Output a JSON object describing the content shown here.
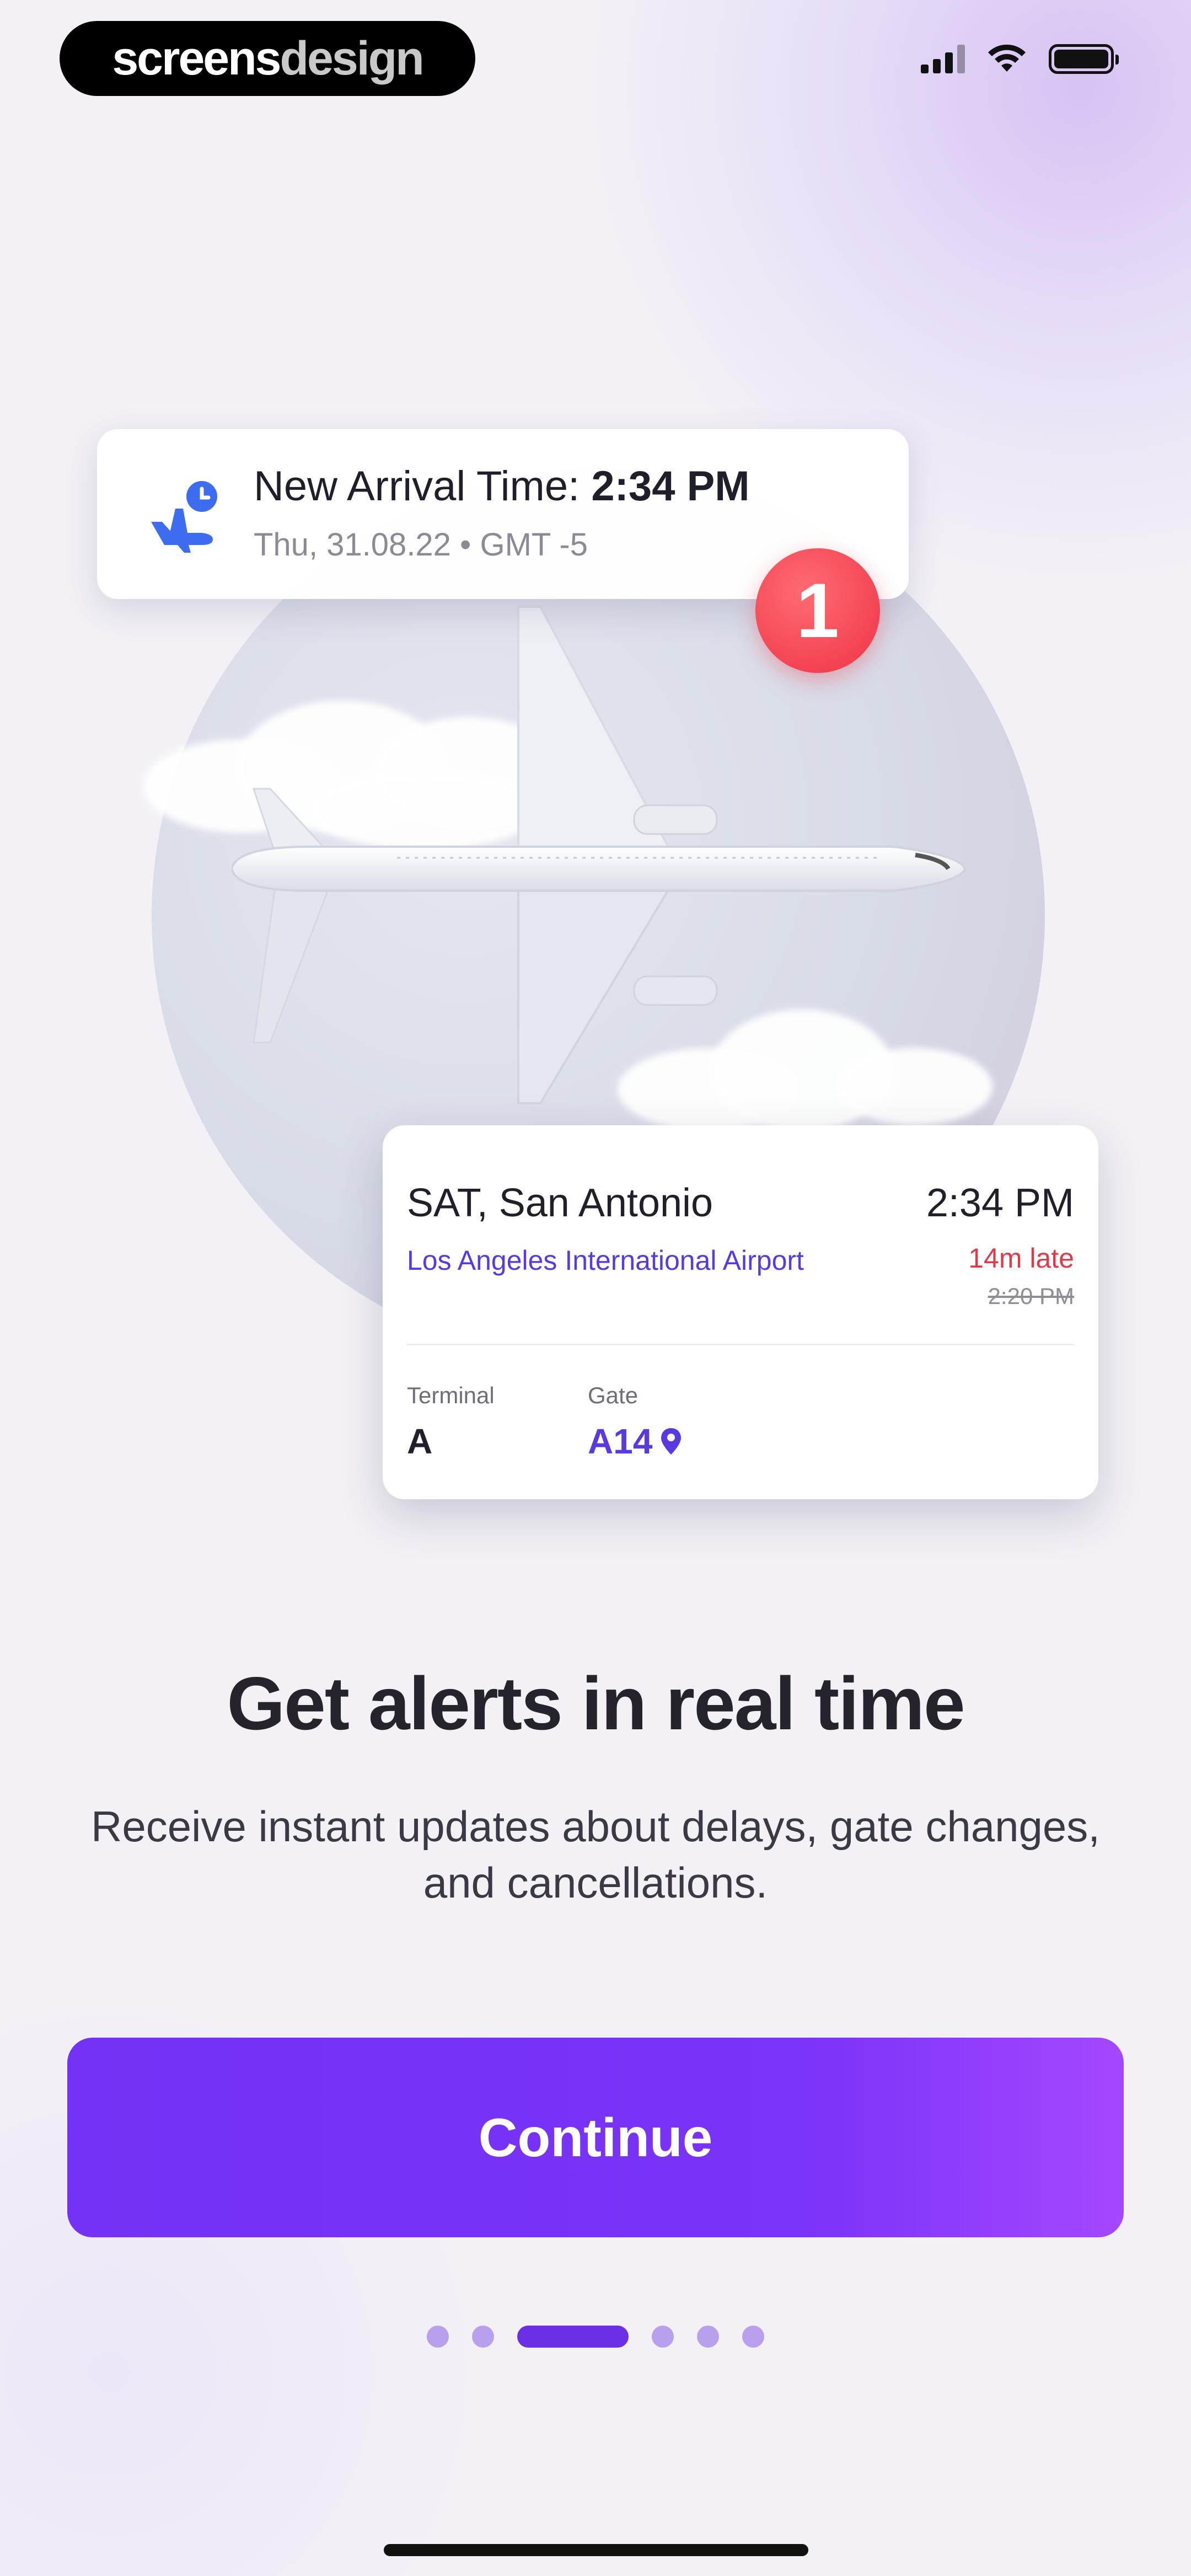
{
  "brand": {
    "part1": "screens",
    "part2": "design"
  },
  "status_bar": {
    "signal_icon": "cellular-signal-icon",
    "wifi_icon": "wifi-icon",
    "battery_icon": "battery-icon"
  },
  "notification": {
    "icon": "plane-clock-icon",
    "title_prefix": "New Arrival Time: ",
    "title_time": "2:34 PM",
    "subtitle": "Thu, 31.08.22 • GMT -5",
    "badge_count": "1"
  },
  "flight_card": {
    "city": "SAT, San Antonio",
    "airport": "Los Angeles International Airport",
    "arrival_time": "2:34 PM",
    "delay": "14m late",
    "original_time": "2:20 PM",
    "terminal_label": "Terminal",
    "terminal_value": "A",
    "gate_label": "Gate",
    "gate_value": "A14",
    "gate_icon": "map-pin-icon"
  },
  "onboarding": {
    "headline": "Get alerts in real time",
    "description": "Receive instant updates about delays, gate changes, and cancellations.",
    "continue_label": "Continue",
    "page_count": 6,
    "current_page": 3
  },
  "colors": {
    "accent": "#7332f5",
    "link": "#5b39e0",
    "danger": "#e0394a",
    "badge": "#ef3346"
  }
}
